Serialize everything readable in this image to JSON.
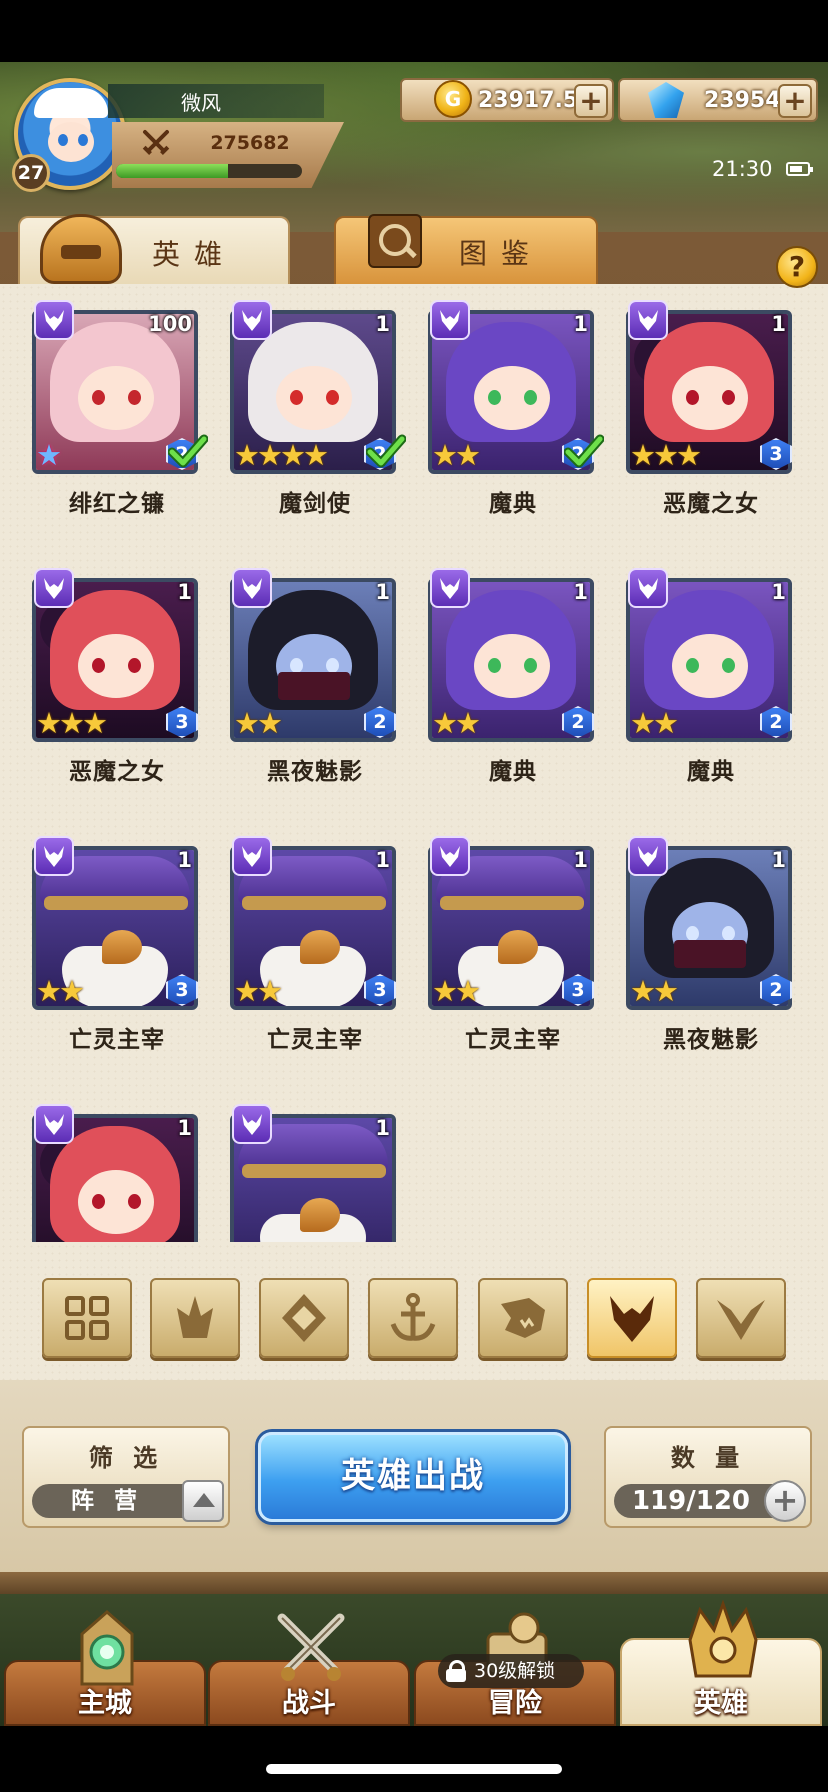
{
  "player": {
    "name": "微风",
    "level": "27",
    "power": "275682",
    "exp_fraction": 0.6
  },
  "currency": {
    "gold": "23917.5K",
    "gems": "23954",
    "gold_symbol": "G",
    "plus_symbol": "+"
  },
  "status": {
    "time": "21:30"
  },
  "tabs": {
    "heroes": "英雄",
    "compendium": "图鉴"
  },
  "help_symbol": "?",
  "heroes": [
    {
      "name": "绯红之镰",
      "level": "100",
      "stars": 1,
      "star_type": "rainbow",
      "grade": "2",
      "checked": true,
      "art": "pink-girl"
    },
    {
      "name": "魔剑使",
      "level": "1",
      "stars": 4,
      "star_type": "gold",
      "grade": "2",
      "checked": true,
      "art": "white-girl"
    },
    {
      "name": "魔典",
      "level": "1",
      "stars": 2,
      "star_type": "gold",
      "grade": "2",
      "checked": true,
      "art": "purple-girl"
    },
    {
      "name": "恶魔之女",
      "level": "1",
      "stars": 3,
      "star_type": "gold",
      "grade": "3",
      "checked": false,
      "art": "demon-girl"
    },
    {
      "name": "恶魔之女",
      "level": "1",
      "stars": 3,
      "star_type": "gold",
      "grade": "3",
      "checked": false,
      "art": "demon-girl"
    },
    {
      "name": "黑夜魅影",
      "level": "1",
      "stars": 2,
      "star_type": "gold",
      "grade": "2",
      "checked": false,
      "art": "night-phantom"
    },
    {
      "name": "魔典",
      "level": "1",
      "stars": 2,
      "star_type": "gold",
      "grade": "2",
      "checked": false,
      "art": "purple-girl"
    },
    {
      "name": "魔典",
      "level": "1",
      "stars": 2,
      "star_type": "gold",
      "grade": "2",
      "checked": false,
      "art": "purple-girl"
    },
    {
      "name": "亡灵主宰",
      "level": "1",
      "stars": 2,
      "star_type": "gold",
      "grade": "3",
      "checked": false,
      "art": "undead-wizard"
    },
    {
      "name": "亡灵主宰",
      "level": "1",
      "stars": 2,
      "star_type": "gold",
      "grade": "3",
      "checked": false,
      "art": "undead-wizard"
    },
    {
      "name": "亡灵主宰",
      "level": "1",
      "stars": 2,
      "star_type": "gold",
      "grade": "3",
      "checked": false,
      "art": "undead-wizard"
    },
    {
      "name": "黑夜魅影",
      "level": "1",
      "stars": 2,
      "star_type": "gold",
      "grade": "2",
      "checked": false,
      "art": "night-phantom"
    },
    {
      "name": "",
      "level": "1",
      "stars": 0,
      "star_type": "gold",
      "grade": "",
      "checked": false,
      "art": "demon-girl"
    },
    {
      "name": "",
      "level": "1",
      "stars": 0,
      "star_type": "gold",
      "grade": "",
      "checked": false,
      "art": "undead-wizard"
    }
  ],
  "faction_filters": [
    {
      "icon": "grid-icon",
      "active": false
    },
    {
      "icon": "flame-icon",
      "active": false
    },
    {
      "icon": "diamond-emblem-icon",
      "active": false
    },
    {
      "icon": "anchor-icon",
      "active": false
    },
    {
      "icon": "beast-head-icon",
      "active": false
    },
    {
      "icon": "horned-demon-icon",
      "active": true
    },
    {
      "icon": "v-wing-icon",
      "active": false
    }
  ],
  "controls": {
    "filter_title": "筛 选",
    "filter_value": "阵 营",
    "deploy_label": "英雄出战",
    "count_title": "数 量",
    "count_value": "119/120"
  },
  "nav": {
    "items": [
      {
        "label": "主城",
        "active": false
      },
      {
        "label": "战斗",
        "active": false
      },
      {
        "label": "冒险",
        "active": false
      },
      {
        "label": "英雄",
        "active": true
      }
    ],
    "lock_text": "30级解锁"
  },
  "colors": {
    "accent_blue": "#3d9ff0",
    "faction_purple": "#5c2db5",
    "star_gold": "#f7c93a",
    "parchment": "#efe8d8"
  }
}
